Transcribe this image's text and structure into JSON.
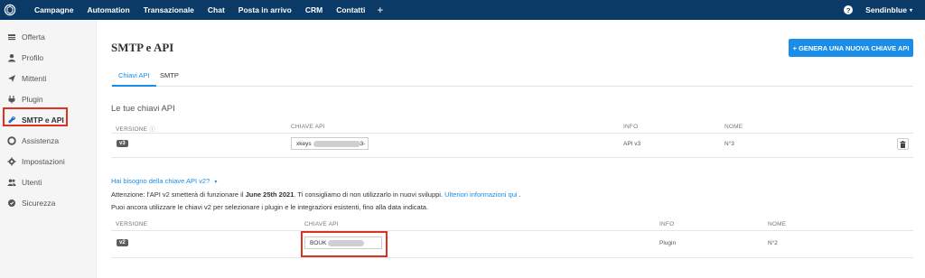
{
  "topbar": {
    "nav": [
      "Campagne",
      "Automation",
      "Transazionale",
      "Chat",
      "Posta in arrivo",
      "CRM",
      "Contatti"
    ],
    "add_symbol": "+",
    "help_symbol": "?",
    "account": "Sendinblue",
    "account_caret": "▾",
    "background_color": "#0b3a66"
  },
  "sidebar": {
    "items": [
      {
        "label": "Offerta",
        "icon": "plan-icon"
      },
      {
        "label": "Profilo",
        "icon": "user-icon"
      },
      {
        "label": "Mittenti",
        "icon": "send-icon"
      },
      {
        "label": "Plugin",
        "icon": "plug-icon"
      },
      {
        "label": "SMTP e API",
        "icon": "wrench-icon",
        "active": true
      },
      {
        "label": "Assistenza",
        "icon": "lifebuoy-icon"
      },
      {
        "label": "Impostazioni",
        "icon": "gear-icon"
      },
      {
        "label": "Utenti",
        "icon": "users-icon"
      },
      {
        "label": "Sicurezza",
        "icon": "lock-icon"
      }
    ]
  },
  "main": {
    "title": "SMTP e API",
    "generate_button": "+ GENERA UNA NUOVA CHIAVE API",
    "tabs": [
      "Chiavi API",
      "SMTP"
    ],
    "section_title": "Le tue chiavi API",
    "v3_table": {
      "headers": {
        "version": "VERSIONE",
        "key": "CHIAVE API",
        "info": "INFO",
        "name": "NOME"
      },
      "row": {
        "version": "v3",
        "key_prefix": "xkeys",
        "key_suffix": "3-",
        "info": "API v3",
        "name": "N°3"
      }
    },
    "v2_toggle": "Hai bisogno della chiave API v2?",
    "toggle_caret": "▾",
    "warning": {
      "prefix": "Attenzione: l'API v2 smetterà di funzionare il ",
      "date": "June 25th 2021",
      "middle": ". Ti consigliamo di non utilizzarlo in nuovi sviluppi. ",
      "link": "Ulteriori informazioni qui",
      "suffix": " .",
      "line2": "Puoi ancora utilizzare le chiavi v2 per selezionare i plugin e le integrazioni esistenti, fino alla data indicata."
    },
    "v2_table": {
      "headers": {
        "version": "VERSIONE",
        "key": "CHIAVE API",
        "info": "INFO",
        "name": "NOME"
      },
      "row": {
        "version": "v2",
        "key_prefix": "BOUK",
        "info": "Plugin",
        "name": "N°2"
      }
    }
  },
  "colors": {
    "accent": "#1a8de9",
    "highlight": "#e0301e"
  }
}
